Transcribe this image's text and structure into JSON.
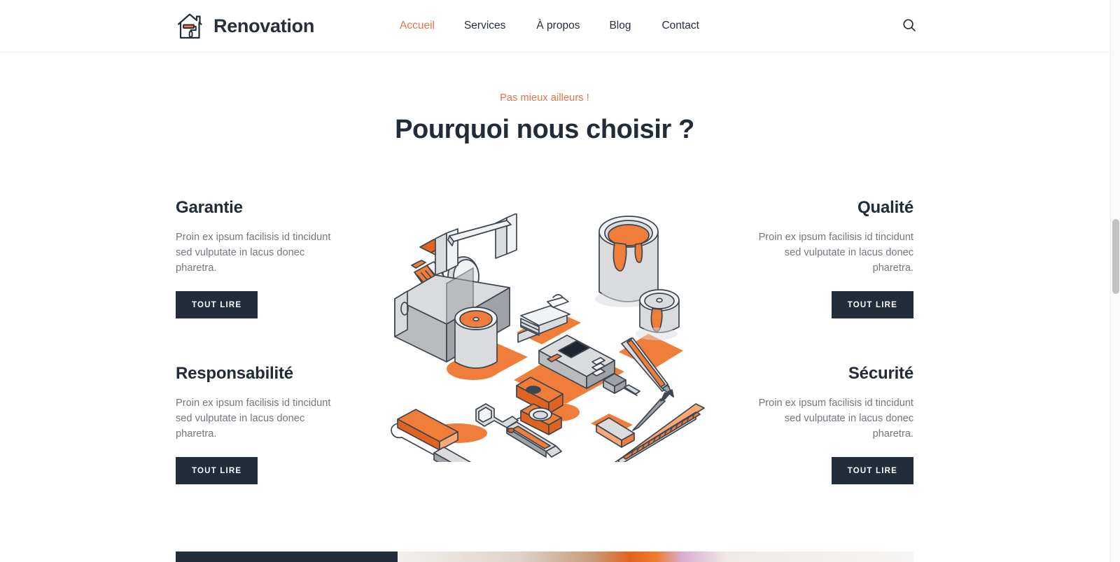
{
  "header": {
    "brand": {
      "name": "Renovation",
      "icon": "house-paint-roller-icon"
    },
    "nav": [
      {
        "label": "Accueil",
        "active": true
      },
      {
        "label": "Services",
        "active": false
      },
      {
        "label": "À propos",
        "active": false
      },
      {
        "label": "Blog",
        "active": false
      },
      {
        "label": "Contact",
        "active": false
      }
    ],
    "search": {
      "icon": "search-icon",
      "aria": "Rechercher"
    }
  },
  "section": {
    "eyebrow": "Pas mieux ailleurs !",
    "title": "Pourquoi nous choisir ?"
  },
  "features": [
    {
      "title": "Garantie",
      "text": "Proin ex ipsum facilisis id tincidunt sed vulputate in lacus donec pharetra.",
      "button": "Tout lire"
    },
    {
      "title": "Qualité",
      "text": "Proin ex ipsum facilisis id tincidunt sed vulputate in lacus donec pharetra.",
      "button": "Tout lire"
    },
    {
      "title": "Responsabilité",
      "text": "Proin ex ipsum facilisis id tincidunt sed vulputate in lacus donec pharetra.",
      "button": "Tout lire"
    },
    {
      "title": "Sécurité",
      "text": "Proin ex ipsum facilisis id tincidunt sed vulputate in lacus donec pharetra.",
      "button": "Tout lire"
    }
  ],
  "illustration": {
    "name": "isometric-renovation-tools-illustration",
    "items": [
      "toolbox",
      "hammer",
      "handsaw",
      "paint-can-open",
      "paint-can-small",
      "paint-roller",
      "wrench",
      "power-drill",
      "tape-measure",
      "screwdriver",
      "pencil",
      "ruler",
      "sandpaper-stack",
      "paint-bucket"
    ]
  },
  "colors": {
    "accent": "#e1744a",
    "accent_illustration": "#f07d3a",
    "dark": "#232c39",
    "heading": "#222b38",
    "body_text": "#72787f",
    "page_bg": "#ffffff",
    "gray_light": "#d8dade",
    "gray_mid": "#9b9ea3"
  },
  "scrollbar": {
    "name": "vertical-scrollbar",
    "position_percent": 42
  }
}
